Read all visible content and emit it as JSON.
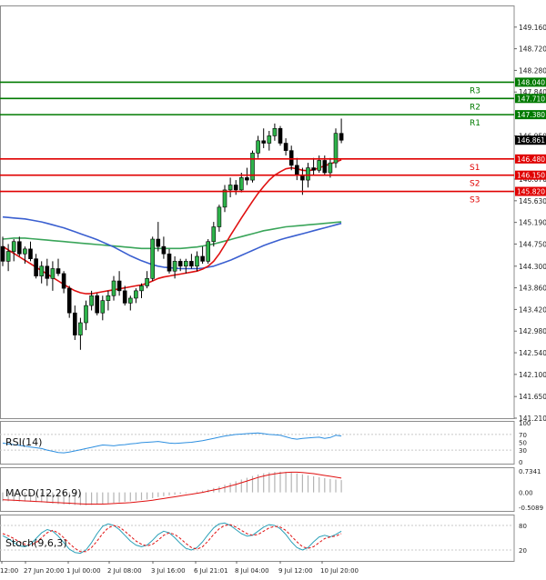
{
  "chart_data": {
    "type": "candlestick",
    "price_axis": {
      "ylim": [
        141.21,
        149.6
      ],
      "ticks": [
        "149.160",
        "148.720",
        "148.280",
        "147.840",
        "146.950",
        "146.070",
        "145.630",
        "145.190",
        "144.750",
        "144.300",
        "143.860",
        "143.420",
        "142.980",
        "142.540",
        "142.100",
        "141.650",
        "141.210"
      ]
    },
    "current_price": {
      "value": 146.861,
      "label": "146.861"
    },
    "levels": [
      {
        "name": "R3",
        "value": 148.04,
        "label": "148.040",
        "color": "#007a00"
      },
      {
        "name": "R2",
        "value": 147.71,
        "label": "147.710",
        "color": "#007a00"
      },
      {
        "name": "R1",
        "value": 147.38,
        "label": "147.380",
        "color": "#007a00"
      },
      {
        "name": "S1",
        "value": 146.48,
        "label": "146.480",
        "color": "#e00000"
      },
      {
        "name": "S2",
        "value": 146.15,
        "label": "146.150",
        "color": "#e00000"
      },
      {
        "name": "S3",
        "value": 145.82,
        "label": "145.820",
        "color": "#e00000"
      }
    ],
    "candles": [
      [
        144.7,
        144.9,
        144.3,
        144.4
      ],
      [
        144.4,
        144.75,
        144.2,
        144.6
      ],
      [
        144.6,
        144.85,
        144.4,
        144.8
      ],
      [
        144.8,
        144.9,
        144.5,
        144.55
      ],
      [
        144.55,
        144.7,
        144.35,
        144.65
      ],
      [
        144.65,
        144.8,
        144.4,
        144.45
      ],
      [
        144.45,
        144.55,
        144.05,
        144.1
      ],
      [
        144.1,
        144.4,
        143.95,
        144.3
      ],
      [
        144.3,
        144.45,
        143.9,
        144.05
      ],
      [
        144.05,
        144.4,
        143.8,
        144.25
      ],
      [
        144.25,
        144.45,
        144.1,
        144.15
      ],
      [
        144.15,
        144.2,
        143.75,
        143.85
      ],
      [
        143.85,
        143.9,
        143.25,
        143.35
      ],
      [
        143.35,
        143.5,
        142.8,
        142.9
      ],
      [
        142.9,
        143.25,
        142.6,
        143.15
      ],
      [
        143.15,
        143.6,
        143.0,
        143.5
      ],
      [
        143.5,
        143.8,
        143.4,
        143.7
      ],
      [
        143.7,
        143.75,
        143.3,
        143.35
      ],
      [
        143.35,
        143.7,
        143.2,
        143.6
      ],
      [
        143.6,
        143.8,
        143.4,
        143.7
      ],
      [
        143.7,
        144.1,
        143.6,
        144.0
      ],
      [
        144.0,
        144.2,
        143.7,
        143.8
      ],
      [
        143.8,
        143.9,
        143.5,
        143.55
      ],
      [
        143.55,
        143.7,
        143.4,
        143.65
      ],
      [
        143.65,
        143.85,
        143.55,
        143.8
      ],
      [
        143.8,
        143.95,
        143.65,
        143.9
      ],
      [
        143.9,
        144.2,
        143.85,
        144.05
      ],
      [
        144.05,
        144.9,
        144.0,
        144.85
      ],
      [
        144.85,
        145.2,
        144.6,
        144.7
      ],
      [
        144.7,
        144.9,
        144.45,
        144.55
      ],
      [
        144.55,
        144.65,
        144.15,
        144.2
      ],
      [
        144.2,
        144.5,
        144.05,
        144.4
      ],
      [
        144.4,
        144.45,
        144.2,
        144.3
      ],
      [
        144.3,
        144.45,
        144.15,
        144.4
      ],
      [
        144.4,
        144.55,
        144.25,
        144.3
      ],
      [
        144.3,
        144.6,
        144.2,
        144.5
      ],
      [
        144.5,
        144.7,
        144.35,
        144.4
      ],
      [
        144.4,
        144.85,
        144.35,
        144.8
      ],
      [
        144.8,
        145.2,
        144.7,
        145.1
      ],
      [
        145.1,
        145.55,
        145.0,
        145.5
      ],
      [
        145.5,
        145.95,
        145.4,
        145.85
      ],
      [
        145.85,
        146.1,
        145.7,
        145.95
      ],
      [
        145.95,
        146.05,
        145.75,
        145.85
      ],
      [
        145.85,
        146.2,
        145.8,
        146.1
      ],
      [
        146.1,
        146.3,
        145.95,
        146.05
      ],
      [
        146.05,
        146.65,
        146.0,
        146.6
      ],
      [
        146.6,
        146.95,
        146.5,
        146.85
      ],
      [
        146.85,
        147.1,
        146.7,
        146.8
      ],
      [
        146.8,
        147.05,
        146.65,
        146.95
      ],
      [
        146.95,
        147.2,
        146.85,
        147.1
      ],
      [
        147.1,
        147.15,
        146.75,
        146.8
      ],
      [
        146.8,
        146.9,
        146.55,
        146.65
      ],
      [
        146.65,
        146.75,
        146.25,
        146.35
      ],
      [
        146.35,
        146.5,
        146.05,
        146.15
      ],
      [
        146.15,
        146.3,
        145.75,
        146.05
      ],
      [
        146.05,
        146.4,
        145.9,
        146.3
      ],
      [
        146.3,
        146.5,
        146.15,
        146.25
      ],
      [
        146.25,
        146.55,
        146.2,
        146.45
      ],
      [
        146.45,
        146.55,
        146.15,
        146.2
      ],
      [
        146.2,
        146.5,
        146.1,
        146.4
      ],
      [
        146.4,
        147.1,
        146.3,
        147.0
      ],
      [
        147.0,
        147.3,
        146.8,
        146.86
      ]
    ],
    "ma_red": [
      144.7,
      144.63,
      144.56,
      144.49,
      144.42,
      144.35,
      144.28,
      144.21,
      144.14,
      144.07,
      144.0,
      143.93,
      143.86,
      143.8,
      143.76,
      143.74,
      143.74,
      143.76,
      143.78,
      143.8,
      143.82,
      143.84,
      143.86,
      143.88,
      143.9,
      143.92,
      143.95,
      144.0,
      144.05,
      144.08,
      144.1,
      144.12,
      144.14,
      144.16,
      144.18,
      144.2,
      144.24,
      144.3,
      144.4,
      144.55,
      144.73,
      144.92,
      145.1,
      145.28,
      145.45,
      145.62,
      145.78,
      145.92,
      146.05,
      146.15,
      146.22,
      146.28,
      146.3,
      146.28,
      146.25,
      146.24,
      146.26,
      146.3,
      146.34,
      146.38,
      146.42,
      146.46
    ],
    "ma_blue": [
      145.3,
      145.29,
      145.28,
      145.27,
      145.26,
      145.24,
      145.22,
      145.2,
      145.17,
      145.14,
      145.11,
      145.08,
      145.04,
      145.0,
      144.96,
      144.92,
      144.88,
      144.84,
      144.79,
      144.74,
      144.69,
      144.63,
      144.57,
      144.51,
      144.46,
      144.41,
      144.37,
      144.33,
      144.3,
      144.28,
      144.27,
      144.26,
      144.25,
      144.25,
      144.25,
      144.25,
      144.26,
      144.28,
      144.3,
      144.34,
      144.38,
      144.42,
      144.47,
      144.52,
      144.57,
      144.62,
      144.67,
      144.72,
      144.76,
      144.8,
      144.84,
      144.87,
      144.9,
      144.93,
      144.96,
      144.99,
      145.02,
      145.05,
      145.08,
      145.11,
      145.14,
      145.17
    ],
    "ma_green": [
      144.85,
      144.86,
      144.87,
      144.87,
      144.87,
      144.86,
      144.85,
      144.84,
      144.83,
      144.82,
      144.81,
      144.8,
      144.79,
      144.78,
      144.77,
      144.76,
      144.75,
      144.74,
      144.73,
      144.72,
      144.71,
      144.7,
      144.69,
      144.68,
      144.67,
      144.66,
      144.66,
      144.66,
      144.66,
      144.66,
      144.66,
      144.66,
      144.66,
      144.67,
      144.68,
      144.69,
      144.71,
      144.73,
      144.75,
      144.78,
      144.81,
      144.84,
      144.87,
      144.9,
      144.93,
      144.96,
      144.99,
      145.02,
      145.04,
      145.06,
      145.08,
      145.1,
      145.11,
      145.12,
      145.13,
      145.14,
      145.15,
      145.16,
      145.17,
      145.18,
      145.19,
      145.2
    ],
    "x_labels": [
      "12:00",
      "27 Jun 20:00",
      "1 Jul 00:00",
      "2 Jul 08:00",
      "3 Jul 16:00",
      "6 Jul 21:01",
      "8 Jul 04:00",
      "9 Jul 12:00",
      "10 Jul 20:00"
    ],
    "rsi": {
      "label": "RSI(14)",
      "ticks": [
        "100",
        "70",
        "50",
        "30",
        "0"
      ],
      "values": [
        48,
        46,
        44,
        42,
        40,
        38,
        36,
        34,
        30,
        27,
        24,
        23,
        25,
        28,
        31,
        34,
        37,
        40,
        43,
        42,
        41,
        43,
        44,
        46,
        47,
        49,
        50,
        51,
        52,
        50,
        48,
        47,
        48,
        49,
        50,
        52,
        54,
        57,
        60,
        63,
        66,
        68,
        70,
        71,
        72,
        73,
        74,
        72,
        70,
        69,
        68,
        64,
        60,
        58,
        60,
        61,
        62,
        63,
        60,
        62,
        68,
        66
      ]
    },
    "macd": {
      "label": "MACD(12,26,9)",
      "ticks": [
        "0.7341",
        "0.00",
        "-0.5089"
      ],
      "hist": [
        -0.3,
        -0.3,
        -0.3,
        -0.31,
        -0.31,
        -0.32,
        -0.33,
        -0.34,
        -0.36,
        -0.38,
        -0.4,
        -0.41,
        -0.42,
        -0.43,
        -0.44,
        -0.44,
        -0.43,
        -0.42,
        -0.4,
        -0.38,
        -0.36,
        -0.34,
        -0.32,
        -0.3,
        -0.28,
        -0.26,
        -0.24,
        -0.2,
        -0.16,
        -0.13,
        -0.1,
        -0.08,
        -0.05,
        -0.03,
        0.0,
        0.03,
        0.06,
        0.1,
        0.15,
        0.2,
        0.26,
        0.32,
        0.38,
        0.44,
        0.5,
        0.56,
        0.61,
        0.65,
        0.68,
        0.7,
        0.71,
        0.7,
        0.68,
        0.65,
        0.62,
        0.58,
        0.55,
        0.52,
        0.49,
        0.46,
        0.44,
        0.42
      ],
      "signal": [
        -0.25,
        -0.26,
        -0.27,
        -0.28,
        -0.29,
        -0.3,
        -0.31,
        -0.32,
        -0.33,
        -0.34,
        -0.35,
        -0.36,
        -0.37,
        -0.38,
        -0.39,
        -0.4,
        -0.4,
        -0.4,
        -0.4,
        -0.39,
        -0.38,
        -0.37,
        -0.36,
        -0.35,
        -0.33,
        -0.31,
        -0.29,
        -0.27,
        -0.24,
        -0.21,
        -0.18,
        -0.15,
        -0.12,
        -0.09,
        -0.06,
        -0.03,
        0.0,
        0.04,
        0.08,
        0.12,
        0.17,
        0.22,
        0.27,
        0.33,
        0.39,
        0.45,
        0.51,
        0.56,
        0.6,
        0.63,
        0.66,
        0.68,
        0.69,
        0.69,
        0.68,
        0.66,
        0.64,
        0.61,
        0.58,
        0.55,
        0.52,
        0.49
      ]
    },
    "stoch": {
      "label": "Stoch(9,6,3)",
      "ticks": [
        "80",
        "20"
      ],
      "main": [
        55,
        48,
        38,
        30,
        28,
        34,
        48,
        62,
        70,
        66,
        54,
        38,
        22,
        14,
        12,
        20,
        38,
        60,
        78,
        84,
        80,
        70,
        56,
        42,
        32,
        28,
        32,
        44,
        58,
        66,
        62,
        50,
        36,
        24,
        20,
        26,
        40,
        58,
        74,
        84,
        86,
        80,
        70,
        60,
        54,
        56,
        66,
        76,
        82,
        80,
        72,
        58,
        40,
        26,
        20,
        26,
        40,
        52,
        56,
        52,
        58,
        66
      ],
      "signal": [
        60,
        55,
        48,
        40,
        34,
        32,
        38,
        50,
        62,
        68,
        62,
        50,
        36,
        24,
        16,
        16,
        26,
        42,
        60,
        74,
        80,
        76,
        66,
        54,
        42,
        34,
        30,
        34,
        44,
        56,
        62,
        58,
        48,
        36,
        26,
        22,
        28,
        42,
        58,
        72,
        80,
        82,
        76,
        68,
        60,
        56,
        58,
        66,
        74,
        78,
        76,
        68,
        54,
        40,
        28,
        24,
        28,
        38,
        48,
        52,
        54,
        60
      ]
    }
  }
}
